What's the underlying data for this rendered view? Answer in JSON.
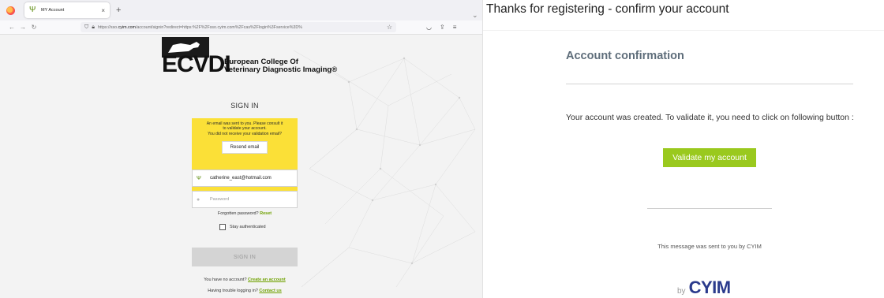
{
  "browser": {
    "tab_title": "MY Account",
    "tab_close": "×",
    "new_tab": "+",
    "url_prefix": "https://sso.",
    "url_domain": "cyim.com",
    "url_rest": "/account/signin?redirect=https:%2F%2Fsso.cyim.com%2Fcas%2Flogin%3Fservice%3D%",
    "icons": [
      "back-icon",
      "forward-icon",
      "reload-icon",
      "shield-icon",
      "lock-icon",
      "bookmark-star-icon",
      "pocket-icon",
      "extensions-icon",
      "menu-icon"
    ]
  },
  "logo": {
    "big": "ECVDI",
    "line1": "European College Of",
    "line2": "Veterinary Diagnostic Imaging®"
  },
  "signin": {
    "title": "SIGN IN",
    "notice_line1": "An email was sent to you. Please consult it",
    "notice_line2": "to validate your account.",
    "notice_line3": "You did not receive your validation email?",
    "resend_label": "Resend email",
    "email_value": "catherine_east@hotmail.com",
    "password_placeholder": "Password",
    "forgot_text": "Forgotten password?",
    "reset_link": "Reset",
    "stay_label": "Stay authenticated",
    "signin_button": "SIGN IN",
    "no_account_text": "You have no account?",
    "create_link": "Create an account",
    "trouble_text": "Having trouble logging in?",
    "contact_link": "Contact us"
  },
  "email": {
    "subject": "Thanks for registering - confirm your account",
    "heading": "Account confirmation",
    "message": "Your account was created. To validate it, you need to click on following button :",
    "validate_button": "Validate my account",
    "footer": "This message was sent to you by CYIM",
    "by": "by",
    "brand": "CYIM"
  },
  "colors": {
    "accent_green": "#9ac91e",
    "link_green": "#6fa100",
    "notice_yellow": "#fbe037",
    "heading_grey": "#5e6d7a",
    "brand_blue": "#2a3a8c"
  }
}
